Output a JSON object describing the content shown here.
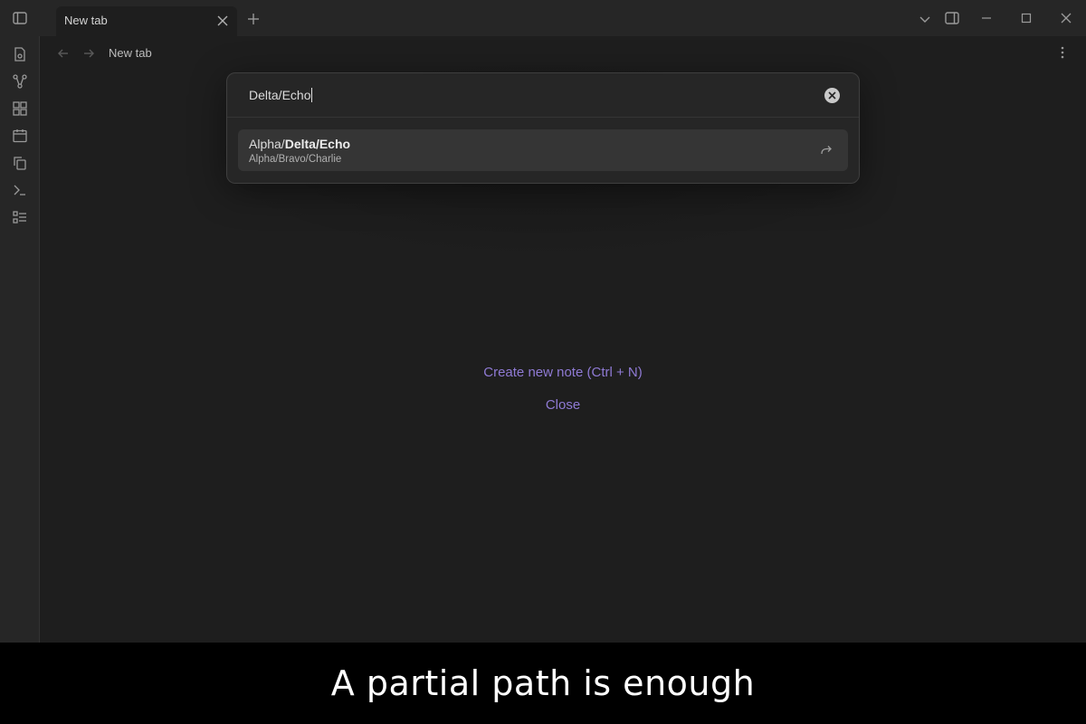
{
  "titlebar": {
    "tab_title": "New tab"
  },
  "view": {
    "title": "New tab",
    "actions": {
      "create_note": "Create new note (Ctrl + N)",
      "close": "Close"
    }
  },
  "switcher": {
    "query": "Delta/Echo",
    "results": [
      {
        "title_prefix": "Alpha/",
        "title_match": "Delta/Echo",
        "path": "Alpha/Bravo/Charlie"
      }
    ]
  },
  "caption": {
    "text": "A partial path is enough"
  },
  "colors": {
    "accent": "#8f7ad4",
    "background": "#1e1e1e",
    "chrome": "#262626"
  }
}
